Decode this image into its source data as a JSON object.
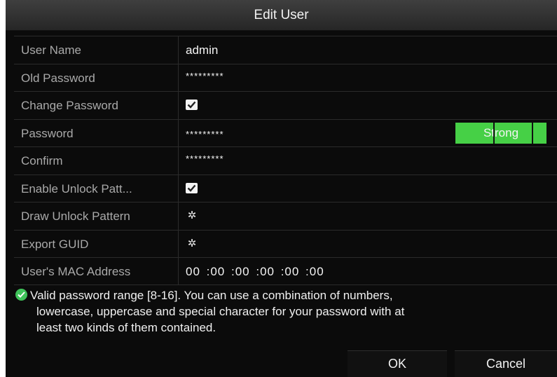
{
  "dialog": {
    "title": "Edit User"
  },
  "form": {
    "user_name": {
      "label": "User Name",
      "value": "admin"
    },
    "old_password": {
      "label": "Old Password",
      "value": "*********"
    },
    "change_password": {
      "label": "Change Password",
      "checked": true
    },
    "password": {
      "label": "Password",
      "value": "*********",
      "strength": "Strong"
    },
    "confirm": {
      "label": "Confirm",
      "value": "*********"
    },
    "enable_unlock_pattern": {
      "label": "Enable Unlock Patt...",
      "checked": true
    },
    "draw_unlock_pattern": {
      "label": "Draw Unlock Pattern",
      "icon": "gear-icon"
    },
    "export_guid": {
      "label": "Export GUID",
      "icon": "gear-icon"
    },
    "mac_address": {
      "label": "User's MAC Address",
      "value": "00 :00 :00 :00 :00 :00"
    }
  },
  "hint": {
    "icon": "check-circle-icon",
    "line1": "Valid password range [8-16]. You can use a combination of numbers,",
    "line2": "lowercase, uppercase and special character for your password with at",
    "line3": "least two kinds of them contained."
  },
  "buttons": {
    "ok": "OK",
    "cancel": "Cancel"
  },
  "colors": {
    "strength_bar": "#46d046",
    "hint_icon": "#3fc35a",
    "background": "#0b0b0b"
  }
}
